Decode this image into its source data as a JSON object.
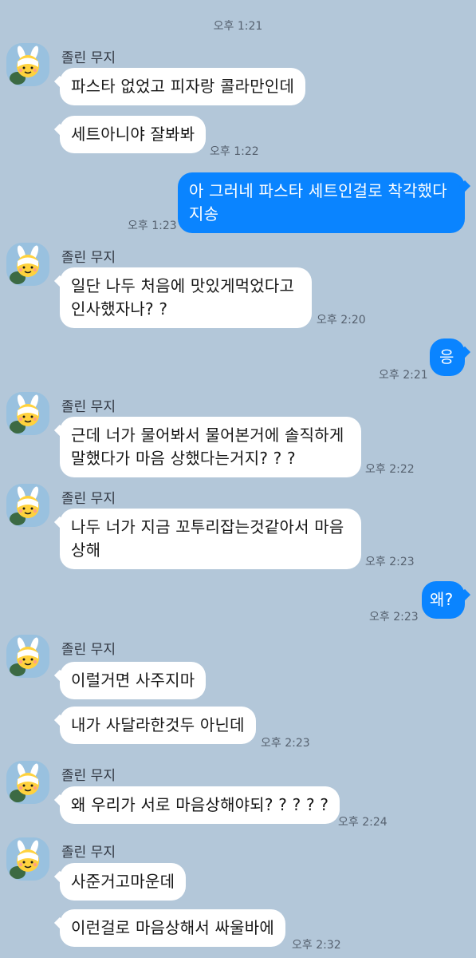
{
  "top_time": "오후 1:21",
  "sender_name": "졸린 무지",
  "messages": [
    {
      "id": "m1",
      "from": "other",
      "text": "파스타 없었고 피자랑 콜라만인데",
      "time": ""
    },
    {
      "id": "m2",
      "from": "other",
      "text": "세트아니야 잘봐봐",
      "time": "오후 1:22"
    },
    {
      "id": "m3",
      "from": "me",
      "text_lines": [
        "아 그러네 파스타 세트인걸로 착각했다",
        "지송"
      ],
      "time": "오후 1:23"
    },
    {
      "id": "m4",
      "from": "other",
      "text_lines": [
        "일단 나두 처음에 맛있게먹었다고",
        "인사했자나? ?"
      ],
      "time": "오후 2:20"
    },
    {
      "id": "m5",
      "from": "me",
      "text": "응",
      "time": "오후 2:21"
    },
    {
      "id": "m6",
      "from": "other",
      "text_lines": [
        "근데 너가 물어봐서 물어본거에 솔직하게",
        "말했다가 마음 상했다는거지? ? ?"
      ],
      "time": "오후 2:22"
    },
    {
      "id": "m7",
      "from": "other",
      "text_lines": [
        "나두 너가 지금 꼬투리잡는것같아서 마음",
        "상해"
      ],
      "time": "오후 2:23"
    },
    {
      "id": "m8",
      "from": "me",
      "text": "왜?",
      "time": "오후 2:23"
    },
    {
      "id": "m9",
      "from": "other",
      "text": "이럴거면 사주지마",
      "time": ""
    },
    {
      "id": "m10",
      "from": "other",
      "text": "내가 사달라한것두 아닌데",
      "time": "오후 2:23"
    },
    {
      "id": "m11",
      "from": "other",
      "text": "왜 우리가 서로 마음상해야되? ? ? ? ?",
      "time": "오후 2:24"
    },
    {
      "id": "m12",
      "from": "other",
      "text": "사준거고마운데",
      "time": ""
    },
    {
      "id": "m13",
      "from": "other",
      "text": "이런걸로 마음상해서 싸울바에",
      "time": "오후 2:32"
    }
  ],
  "colors": {
    "background": "#b3c7d9",
    "incoming_bubble": "#ffffff",
    "outgoing_bubble": "#0a84ff",
    "meta_text": "#56616f"
  },
  "icons": {
    "avatar": "muzi-bunny-avatar-icon"
  }
}
